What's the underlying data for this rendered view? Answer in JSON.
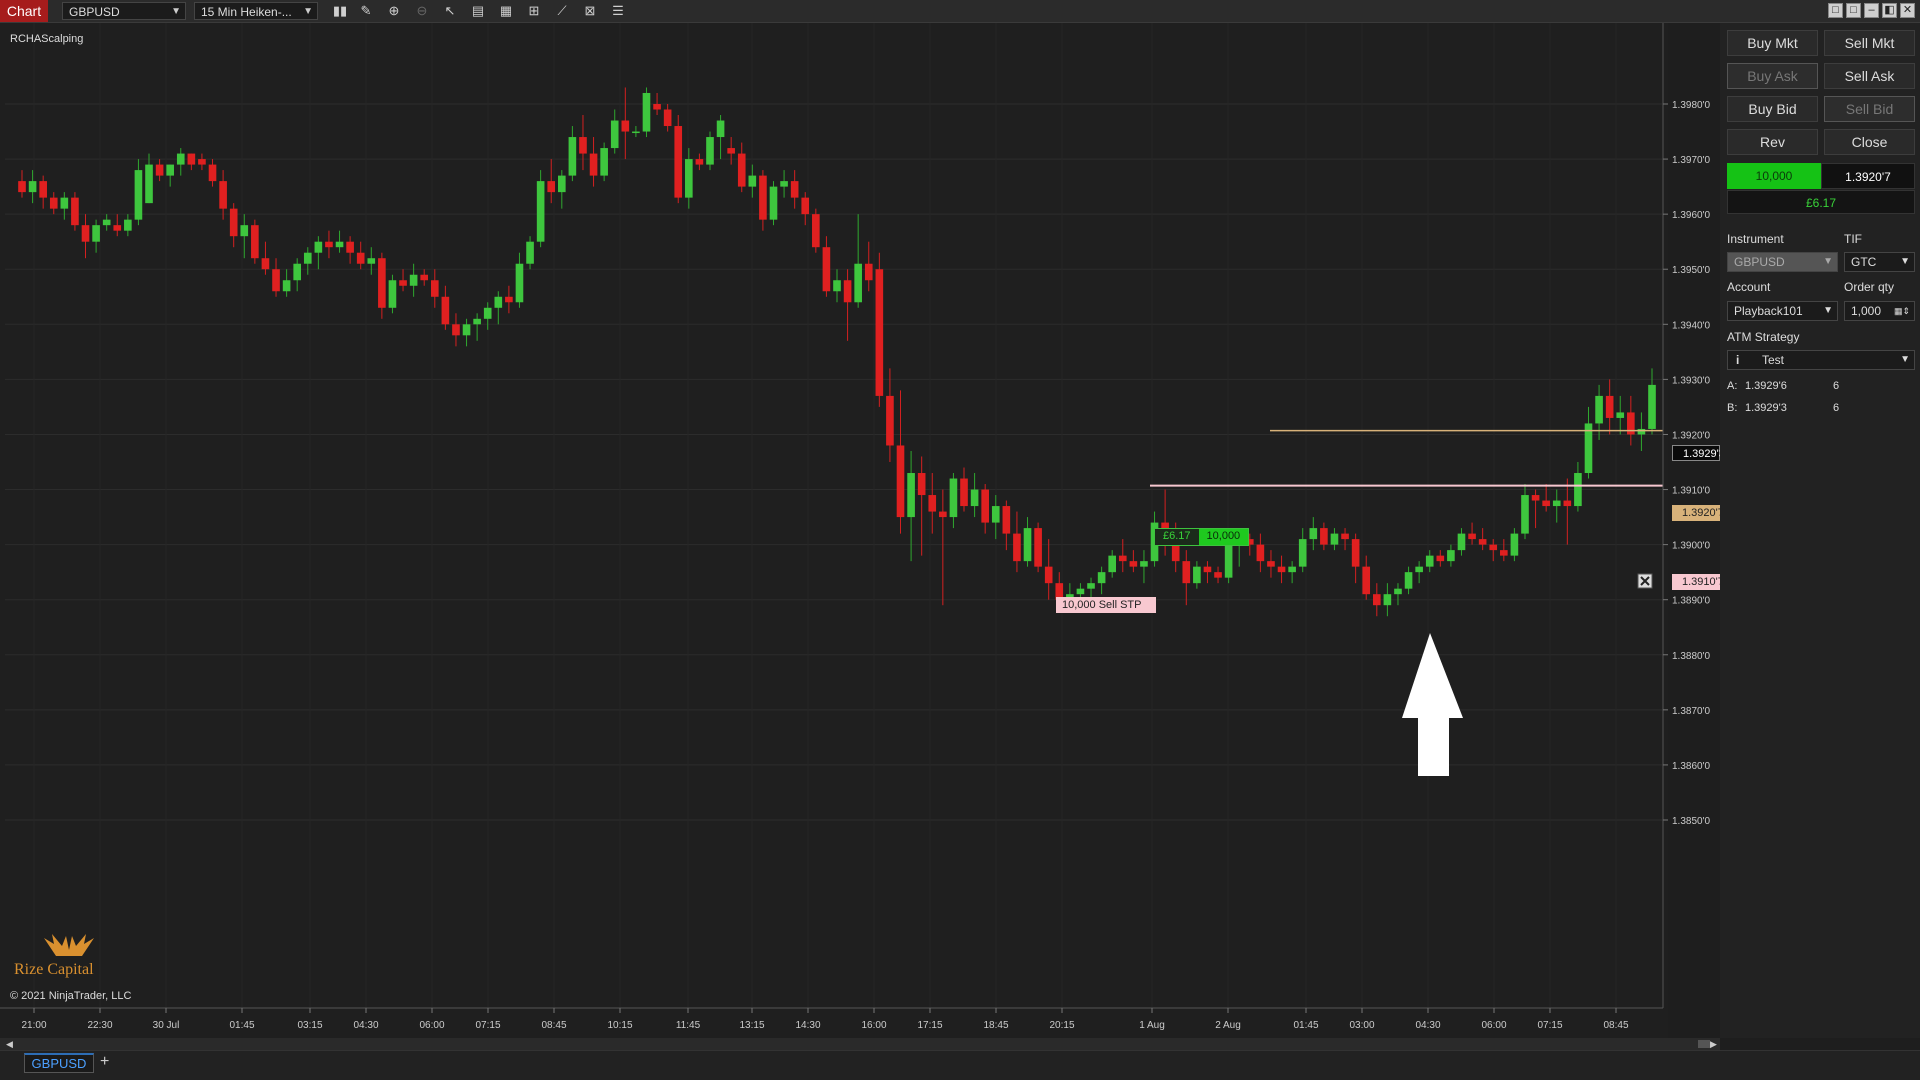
{
  "toolbar": {
    "chart_tab": "Chart",
    "instrument": "GBPUSD",
    "interval": "15 Min Heiken-...",
    "icons": [
      "bar-type-icon",
      "draw-tool-icon",
      "zoom-in-icon",
      "zoom-out-icon",
      "pointer-icon",
      "data-box-icon",
      "chart-trader-icon",
      "properties-icon",
      "indicators-icon",
      "strategy-icon",
      "list-icon"
    ],
    "window_buttons": [
      "□",
      "□",
      "–",
      "◧",
      "✕"
    ]
  },
  "chart": {
    "indicator_label": "RCHAScalping",
    "copyright": "© 2021 NinjaTrader, LLC",
    "logo_text": "Rize Capital",
    "price_axis": [
      "1.3980'0",
      "1.3970'0",
      "1.3960'0",
      "1.3950'0",
      "1.3940'0",
      "1.3930'0",
      "1.3920'0",
      "1.3910'0",
      "1.3900'0",
      "1.3890'0",
      "1.3880'0",
      "1.3870'0",
      "1.3860'0",
      "1.3850'0"
    ],
    "time_axis": [
      "21:00",
      "22:30",
      "30 Jul",
      "01:45",
      "03:15",
      "04:30",
      "06:00",
      "07:15",
      "08:45",
      "10:15",
      "11:45",
      "13:15",
      "14:30",
      "16:00",
      "17:15",
      "18:45",
      "20:15",
      "1 Aug",
      "2 Aug",
      "01:45",
      "03:00",
      "04:30",
      "06:00",
      "07:15",
      "08:45"
    ],
    "last_price_label": "1.3929'3",
    "position_price_label": "1.3920'7",
    "stop_price_label": "1.3910'7",
    "position_pnl": "£6.17",
    "position_qty": "10,000",
    "stop_order_label": "10,000   Sell STP",
    "colors": {
      "bull": "#3ec63e",
      "bear": "#e02020",
      "wick_bull": "#2fa82f",
      "wick_bear": "#d42020",
      "position_line": "#d8b27a",
      "stop_line": "#f8c8d0"
    }
  },
  "chart_data": {
    "type": "candlestick",
    "series_note": "Heiken-Ashi 15 min, prices read from axis",
    "ylim": [
      1.3848,
      1.3993
    ],
    "candles": [
      [
        1.3966,
        1.3968,
        1.3963,
        1.3964
      ],
      [
        1.3964,
        1.3968,
        1.3962,
        1.3966
      ],
      [
        1.3966,
        1.3967,
        1.3961,
        1.3963
      ],
      [
        1.3963,
        1.3964,
        1.396,
        1.3961
      ],
      [
        1.3961,
        1.3964,
        1.3959,
        1.3963
      ],
      [
        1.3963,
        1.3964,
        1.3957,
        1.3958
      ],
      [
        1.3958,
        1.396,
        1.3952,
        1.3955
      ],
      [
        1.3955,
        1.3959,
        1.3953,
        1.3958
      ],
      [
        1.3958,
        1.396,
        1.3957,
        1.3959
      ],
      [
        1.3958,
        1.396,
        1.3956,
        1.3957
      ],
      [
        1.3957,
        1.396,
        1.3956,
        1.3959
      ],
      [
        1.3959,
        1.397,
        1.3958,
        1.3968
      ],
      [
        1.3962,
        1.3971,
        1.3962,
        1.3969
      ],
      [
        1.3969,
        1.397,
        1.3966,
        1.3967
      ],
      [
        1.3967,
        1.3969,
        1.3965,
        1.3969
      ],
      [
        1.3969,
        1.3972,
        1.3967,
        1.3971
      ],
      [
        1.3971,
        1.3971,
        1.3968,
        1.3969
      ],
      [
        1.397,
        1.3971,
        1.3968,
        1.3969
      ],
      [
        1.3969,
        1.397,
        1.3965,
        1.3966
      ],
      [
        1.3966,
        1.3968,
        1.3959,
        1.3961
      ],
      [
        1.3961,
        1.3962,
        1.3954,
        1.3956
      ],
      [
        1.3956,
        1.396,
        1.3952,
        1.3958
      ],
      [
        1.3958,
        1.3959,
        1.3951,
        1.3952
      ],
      [
        1.3952,
        1.3955,
        1.3949,
        1.395
      ],
      [
        1.395,
        1.3952,
        1.3945,
        1.3946
      ],
      [
        1.3946,
        1.395,
        1.3945,
        1.3948
      ],
      [
        1.3948,
        1.3952,
        1.3946,
        1.3951
      ],
      [
        1.3951,
        1.3954,
        1.3949,
        1.3953
      ],
      [
        1.3953,
        1.3956,
        1.395,
        1.3955
      ],
      [
        1.3955,
        1.3957,
        1.3952,
        1.3954
      ],
      [
        1.3954,
        1.3957,
        1.3953,
        1.3955
      ],
      [
        1.3955,
        1.3956,
        1.3951,
        1.3953
      ],
      [
        1.3953,
        1.3955,
        1.395,
        1.3951
      ],
      [
        1.3951,
        1.3954,
        1.3949,
        1.3952
      ],
      [
        1.3952,
        1.3953,
        1.3941,
        1.3943
      ],
      [
        1.3943,
        1.3949,
        1.3942,
        1.3948
      ],
      [
        1.3948,
        1.395,
        1.3946,
        1.3947
      ],
      [
        1.3947,
        1.3951,
        1.3945,
        1.3949
      ],
      [
        1.3949,
        1.395,
        1.3947,
        1.3948
      ],
      [
        1.3948,
        1.395,
        1.3943,
        1.3945
      ],
      [
        1.3945,
        1.3947,
        1.3939,
        1.394
      ],
      [
        1.394,
        1.3942,
        1.3936,
        1.3938
      ],
      [
        1.3938,
        1.3941,
        1.3936,
        1.394
      ],
      [
        1.394,
        1.3942,
        1.3937,
        1.3941
      ],
      [
        1.3941,
        1.3944,
        1.3939,
        1.3943
      ],
      [
        1.3943,
        1.3946,
        1.394,
        1.3945
      ],
      [
        1.3945,
        1.3947,
        1.3942,
        1.3944
      ],
      [
        1.3944,
        1.3953,
        1.3943,
        1.3951
      ],
      [
        1.3951,
        1.3956,
        1.395,
        1.3955
      ],
      [
        1.3955,
        1.3968,
        1.3954,
        1.3966
      ],
      [
        1.3966,
        1.397,
        1.3962,
        1.3964
      ],
      [
        1.3964,
        1.3968,
        1.3961,
        1.3967
      ],
      [
        1.3967,
        1.3976,
        1.3966,
        1.3974
      ],
      [
        1.3974,
        1.3978,
        1.3968,
        1.3971
      ],
      [
        1.3971,
        1.3974,
        1.3965,
        1.3967
      ],
      [
        1.3967,
        1.3973,
        1.3966,
        1.3972
      ],
      [
        1.3972,
        1.3979,
        1.3971,
        1.3977
      ],
      [
        1.3977,
        1.3983,
        1.397,
        1.3975
      ],
      [
        1.3975,
        1.3976,
        1.3974,
        1.3975
      ],
      [
        1.3975,
        1.3983,
        1.3974,
        1.3982
      ],
      [
        1.398,
        1.3982,
        1.3978,
        1.3979
      ],
      [
        1.3979,
        1.398,
        1.3975,
        1.3976
      ],
      [
        1.3976,
        1.3978,
        1.3962,
        1.3963
      ],
      [
        1.3963,
        1.3972,
        1.3961,
        1.397
      ],
      [
        1.397,
        1.3971,
        1.3968,
        1.3969
      ],
      [
        1.3969,
        1.3975,
        1.3968,
        1.3974
      ],
      [
        1.3974,
        1.3978,
        1.397,
        1.3977
      ],
      [
        1.3972,
        1.3974,
        1.3969,
        1.3971
      ],
      [
        1.3971,
        1.3973,
        1.3964,
        1.3965
      ],
      [
        1.3965,
        1.3969,
        1.3963,
        1.3967
      ],
      [
        1.3967,
        1.3968,
        1.3957,
        1.3959
      ],
      [
        1.3959,
        1.3966,
        1.3958,
        1.3965
      ],
      [
        1.3965,
        1.3968,
        1.3963,
        1.3966
      ],
      [
        1.3966,
        1.3968,
        1.3961,
        1.3963
      ],
      [
        1.3963,
        1.3964,
        1.3958,
        1.396
      ],
      [
        1.396,
        1.3961,
        1.3953,
        1.3954
      ],
      [
        1.3954,
        1.3956,
        1.3945,
        1.3946
      ],
      [
        1.3946,
        1.395,
        1.3944,
        1.3948
      ],
      [
        1.3948,
        1.395,
        1.3937,
        1.3944
      ],
      [
        1.3944,
        1.396,
        1.3943,
        1.3951
      ],
      [
        1.3951,
        1.3955,
        1.3946,
        1.3948
      ],
      [
        1.395,
        1.3953,
        1.3925,
        1.3927
      ],
      [
        1.3927,
        1.3932,
        1.3915,
        1.3918
      ],
      [
        1.3918,
        1.3928,
        1.3902,
        1.3905
      ],
      [
        1.3905,
        1.3917,
        1.3897,
        1.3913
      ],
      [
        1.3913,
        1.3916,
        1.3898,
        1.3909
      ],
      [
        1.3909,
        1.3913,
        1.3902,
        1.3906
      ],
      [
        1.3906,
        1.391,
        1.3889,
        1.3905
      ],
      [
        1.3905,
        1.3913,
        1.3903,
        1.3912
      ],
      [
        1.3912,
        1.3914,
        1.3906,
        1.3907
      ],
      [
        1.3907,
        1.3913,
        1.3905,
        1.391
      ],
      [
        1.391,
        1.3911,
        1.3902,
        1.3904
      ],
      [
        1.3904,
        1.3909,
        1.3901,
        1.3907
      ],
      [
        1.3907,
        1.3908,
        1.3899,
        1.3902
      ],
      [
        1.3902,
        1.3906,
        1.3895,
        1.3897
      ],
      [
        1.3897,
        1.3905,
        1.3896,
        1.3903
      ],
      [
        1.3903,
        1.3904,
        1.3895,
        1.3896
      ],
      [
        1.3896,
        1.3901,
        1.389,
        1.3893
      ],
      [
        1.3893,
        1.3895,
        1.3888,
        1.389
      ],
      [
        1.389,
        1.3893,
        1.3889,
        1.3891
      ],
      [
        1.3891,
        1.3893,
        1.389,
        1.3892
      ],
      [
        1.3892,
        1.3894,
        1.389,
        1.3893
      ],
      [
        1.3893,
        1.3896,
        1.3891,
        1.3895
      ],
      [
        1.3895,
        1.3899,
        1.3894,
        1.3898
      ],
      [
        1.3898,
        1.3901,
        1.3895,
        1.3897
      ],
      [
        1.3897,
        1.3899,
        1.3895,
        1.3896
      ],
      [
        1.3896,
        1.3899,
        1.3893,
        1.3897
      ],
      [
        1.3897,
        1.3906,
        1.3896,
        1.3904
      ],
      [
        1.3904,
        1.391,
        1.3898,
        1.3901
      ],
      [
        1.3901,
        1.3904,
        1.3895,
        1.3897
      ],
      [
        1.3897,
        1.3899,
        1.3889,
        1.3893
      ],
      [
        1.3893,
        1.3897,
        1.3892,
        1.3896
      ],
      [
        1.3896,
        1.3897,
        1.3893,
        1.3895
      ],
      [
        1.3895,
        1.3896,
        1.3893,
        1.3894
      ],
      [
        1.3894,
        1.3901,
        1.3893,
        1.39
      ],
      [
        1.39,
        1.3903,
        1.3896,
        1.3901
      ],
      [
        1.3901,
        1.3902,
        1.3898,
        1.39
      ],
      [
        1.39,
        1.3902,
        1.3895,
        1.3897
      ],
      [
        1.3897,
        1.3899,
        1.3894,
        1.3896
      ],
      [
        1.3896,
        1.3898,
        1.3893,
        1.3895
      ],
      [
        1.3895,
        1.3897,
        1.3893,
        1.3896
      ],
      [
        1.3896,
        1.3903,
        1.3895,
        1.3901
      ],
      [
        1.3901,
        1.3905,
        1.3899,
        1.3903
      ],
      [
        1.3903,
        1.3904,
        1.3899,
        1.39
      ],
      [
        1.39,
        1.3903,
        1.3899,
        1.3902
      ],
      [
        1.3902,
        1.3903,
        1.3899,
        1.3901
      ],
      [
        1.3901,
        1.3902,
        1.3893,
        1.3896
      ],
      [
        1.3896,
        1.3898,
        1.389,
        1.3891
      ],
      [
        1.3891,
        1.3893,
        1.3887,
        1.3889
      ],
      [
        1.3889,
        1.3893,
        1.3887,
        1.3891
      ],
      [
        1.3891,
        1.3893,
        1.3889,
        1.3892
      ],
      [
        1.3892,
        1.3896,
        1.3891,
        1.3895
      ],
      [
        1.3895,
        1.3897,
        1.3893,
        1.3896
      ],
      [
        1.3896,
        1.3899,
        1.3895,
        1.3898
      ],
      [
        1.3898,
        1.3899,
        1.3896,
        1.3897
      ],
      [
        1.3897,
        1.39,
        1.3896,
        1.3899
      ],
      [
        1.3899,
        1.3903,
        1.3898,
        1.3902
      ],
      [
        1.3902,
        1.3904,
        1.39,
        1.3901
      ],
      [
        1.3901,
        1.3903,
        1.3899,
        1.39
      ],
      [
        1.39,
        1.3901,
        1.3897,
        1.3899
      ],
      [
        1.3899,
        1.3901,
        1.3897,
        1.3898
      ],
      [
        1.3898,
        1.3903,
        1.3897,
        1.3902
      ],
      [
        1.3902,
        1.3911,
        1.3901,
        1.3909
      ],
      [
        1.3909,
        1.391,
        1.3903,
        1.3908
      ],
      [
        1.3908,
        1.3911,
        1.3906,
        1.3907
      ],
      [
        1.3907,
        1.391,
        1.3904,
        1.3908
      ],
      [
        1.3908,
        1.3912,
        1.39,
        1.3907
      ],
      [
        1.3907,
        1.3915,
        1.3906,
        1.3913
      ],
      [
        1.3913,
        1.3925,
        1.3912,
        1.3922
      ],
      [
        1.3922,
        1.3929,
        1.3919,
        1.3927
      ],
      [
        1.3927,
        1.393,
        1.392,
        1.3923
      ],
      [
        1.3923,
        1.3927,
        1.392,
        1.3924
      ],
      [
        1.3924,
        1.3927,
        1.3918,
        1.392
      ],
      [
        1.392,
        1.3924,
        1.3917,
        1.3921
      ],
      [
        1.3921,
        1.3932,
        1.392,
        1.3929
      ]
    ]
  },
  "side": {
    "buttons": [
      {
        "label": "Buy Mkt",
        "disabled": false
      },
      {
        "label": "Sell Mkt",
        "disabled": false
      },
      {
        "label": "Buy Ask",
        "disabled": true
      },
      {
        "label": "Sell Ask",
        "disabled": false
      },
      {
        "label": "Buy Bid",
        "disabled": false
      },
      {
        "label": "Sell Bid",
        "disabled": true
      },
      {
        "label": "Rev",
        "disabled": false
      },
      {
        "label": "Close",
        "disabled": false
      }
    ],
    "position_qty": "10,000",
    "position_price": "1.3920'7",
    "position_pnl": "£6.17",
    "instrument_label": "Instrument",
    "instrument_value": "GBPUSD",
    "tif_label": "TIF",
    "tif_value": "GTC",
    "account_label": "Account",
    "account_value": "Playback101",
    "order_qty_label": "Order qty",
    "order_qty_value": "1,000",
    "atm_label": "ATM Strategy",
    "atm_value": "Test",
    "ask_label": "A:",
    "ask_price": "1.3929'6",
    "ask_size": "6",
    "bid_label": "B:",
    "bid_price": "1.3929'3",
    "bid_size": "6"
  },
  "bottom": {
    "tab": "GBPUSD",
    "add": "+"
  }
}
